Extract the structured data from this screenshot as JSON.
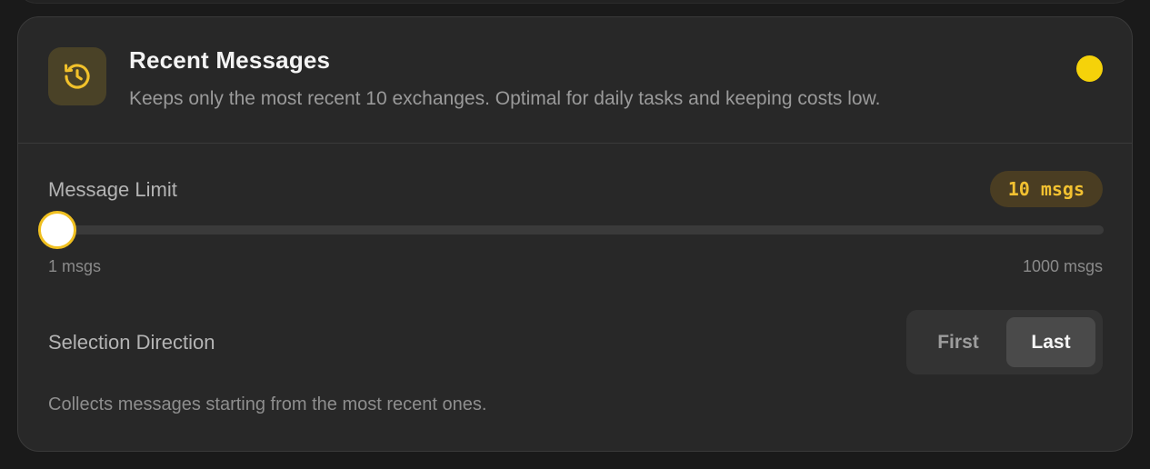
{
  "card": {
    "title": "Recent Messages",
    "description": "Keeps only the most recent 10 exchanges. Optimal for daily tasks and keeping costs low.",
    "icon": "history-icon",
    "status_color": "#f5d20a"
  },
  "message_limit": {
    "label": "Message Limit",
    "value_badge": "10 msgs",
    "value": 10,
    "min": 1,
    "max": 1000,
    "min_label": "1 msgs",
    "max_label": "1000 msgs",
    "accent_color": "#f0c020"
  },
  "selection_direction": {
    "label": "Selection Direction",
    "options": [
      "First",
      "Last"
    ],
    "selected": "Last",
    "help_text": "Collects messages starting from the most recent ones."
  }
}
